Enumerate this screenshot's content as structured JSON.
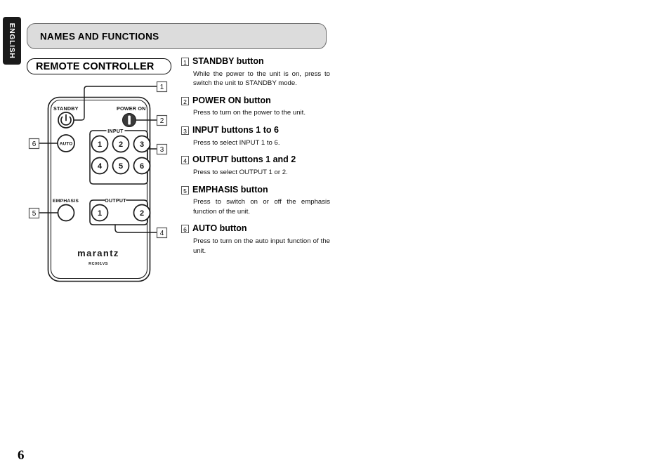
{
  "language_tab": {
    "label": "ENGLISH"
  },
  "section_header": {
    "title": "NAMES AND FUNCTIONS"
  },
  "sub_header": {
    "title": "REMOTE CONTROLLER"
  },
  "page": {
    "number": "6"
  },
  "colors": {
    "header_fill": "#dcdcdc",
    "header_border": "#6e6e6e",
    "tab_background": "#1a1a1a",
    "tab_text": "#ffffff",
    "line": "#1a1a1a",
    "power_button_fill": "#3a3a3a"
  },
  "remote": {
    "brand": "marantz",
    "model": "RC001VS",
    "labels": {
      "standby": "STANDBY",
      "power_on": "POWER ON",
      "input_group": "INPUT",
      "output_group": "OUTPUT",
      "emphasis": "EMPHASIS",
      "auto": "AUTO"
    },
    "input_buttons": [
      "1",
      "2",
      "3",
      "4",
      "5",
      "6"
    ],
    "output_buttons": [
      "1",
      "2"
    ],
    "callouts": [
      "1",
      "2",
      "3",
      "4",
      "5",
      "6"
    ]
  },
  "descriptions": [
    {
      "num": "1",
      "title": "STANDBY button",
      "body": "While the power to the unit is on, press to switch the unit to STANDBY mode."
    },
    {
      "num": "2",
      "title": "POWER ON button",
      "body": "Press to turn on the power to the unit."
    },
    {
      "num": "3",
      "title": "INPUT buttons 1 to 6",
      "body": "Press to select INPUT 1 to 6."
    },
    {
      "num": "4",
      "title": "OUTPUT buttons 1 and 2",
      "body": "Press to select OUTPUT 1 or 2."
    },
    {
      "num": "5",
      "title": "EMPHASIS button",
      "body": "Press to switch on or off the emphasis function of the unit."
    },
    {
      "num": "6",
      "title": "AUTO button",
      "body": "Press to turn on the auto input function of the unit."
    }
  ]
}
